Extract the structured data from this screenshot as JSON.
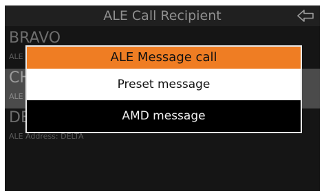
{
  "header": {
    "title": "ALE Call Recipient",
    "back_icon": "back-arrow-icon"
  },
  "recipients": [
    {
      "name": "BRAVO",
      "address": "ALE Address: BRAVO"
    },
    {
      "name": "CHARLIE",
      "address": "ALE Address: CHARLIE"
    },
    {
      "name": "DELTA",
      "address": "ALE Address: DELTA"
    }
  ],
  "dialog": {
    "title": "ALE Message call",
    "options": [
      "Preset message",
      "AMD message"
    ]
  },
  "colors": {
    "accent": "#ef7d23",
    "background": "#151515",
    "selected_row": "#4b4b4b"
  }
}
